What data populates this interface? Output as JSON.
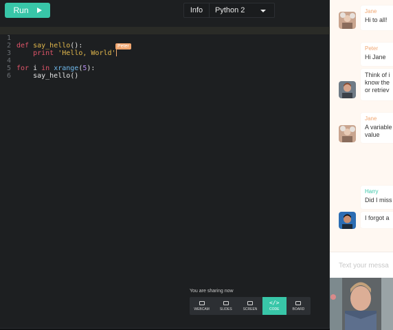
{
  "toolbar": {
    "run_label": "Run",
    "info_label": "Info",
    "language": "Python 2"
  },
  "editor": {
    "line_numbers": [
      "1",
      "2",
      "3",
      "4",
      "5",
      "6"
    ],
    "code": {
      "l1": {
        "kw": "def",
        "fn": "say_hello",
        "rest": "():"
      },
      "l2": {
        "indent": "    ",
        "kw": "print",
        "sp": " ",
        "str": "'Hello, World'"
      },
      "l4": {
        "kw1": "for",
        "var": " i ",
        "kw2": "in",
        "sp": " ",
        "bi": "xrange",
        "p1": "(",
        "num": "5",
        "p2": "):"
      },
      "l5": {
        "text": "    say_hello()"
      }
    },
    "cursor_user": "Peter"
  },
  "sharing": {
    "label": "You are sharing now",
    "buttons": [
      "WEBCAM",
      "SLIDES",
      "SCREEN",
      "CODE",
      "BOARD"
    ],
    "active": "CODE"
  },
  "chat": {
    "messages": [
      {
        "name": "Jane",
        "name_color": "#f0a670",
        "text": "Hi to all!"
      },
      {
        "name": "Peter",
        "name_color": "#f0a670",
        "text": "Hi Jane"
      },
      {
        "name": "",
        "text": "Think of i\nknow the\nor retriev"
      },
      {
        "name": "Jane",
        "name_color": "#f0a670",
        "text": "A variable\nvalue"
      },
      {
        "name": "Harry",
        "name_color": "#38c6a8",
        "text": "Did I miss"
      },
      {
        "name": "",
        "text": "I forgot a"
      }
    ],
    "input_placeholder": "Text your messa"
  },
  "colors": {
    "accent": "#38c6a8",
    "cursor": "#f0a670"
  }
}
